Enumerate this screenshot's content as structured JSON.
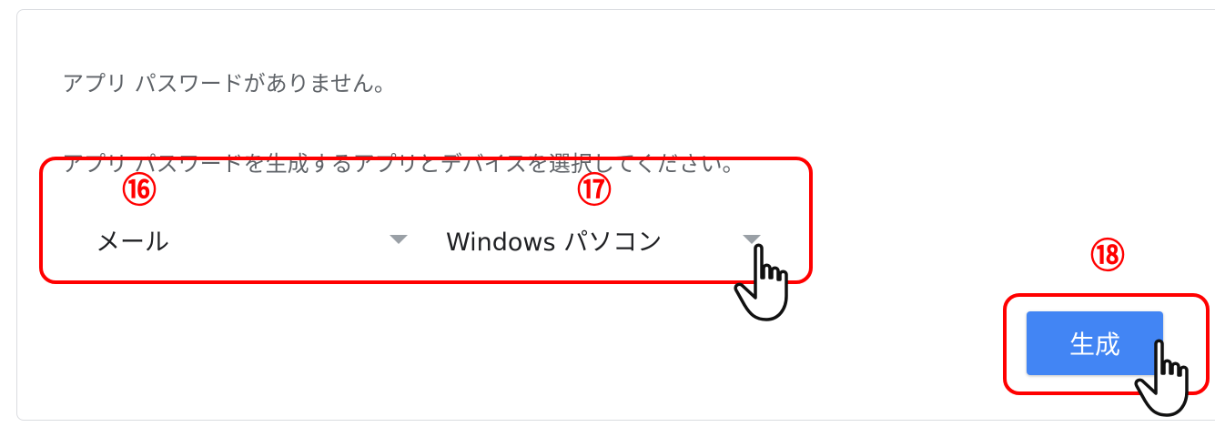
{
  "messages": {
    "no_passwords": "アプリ パスワードがありません。",
    "select_instruction": "アプリ パスワードを生成するアプリとデバイスを選択してください。"
  },
  "app_select": {
    "selected": "メール"
  },
  "device_select": {
    "selected": "Windows パソコン"
  },
  "generate_button": {
    "label": "生成"
  },
  "annotations": {
    "step_select_app": "⑯",
    "step_select_device": "⑰",
    "step_generate": "⑱",
    "highlight_color": "#ff0000"
  },
  "colors": {
    "button_blue": "#4285f4",
    "text_gray": "#5f6368",
    "border_gray": "#dadce0"
  },
  "icons": [
    "dropdown-arrow-icon",
    "pointer-hand-icon"
  ]
}
